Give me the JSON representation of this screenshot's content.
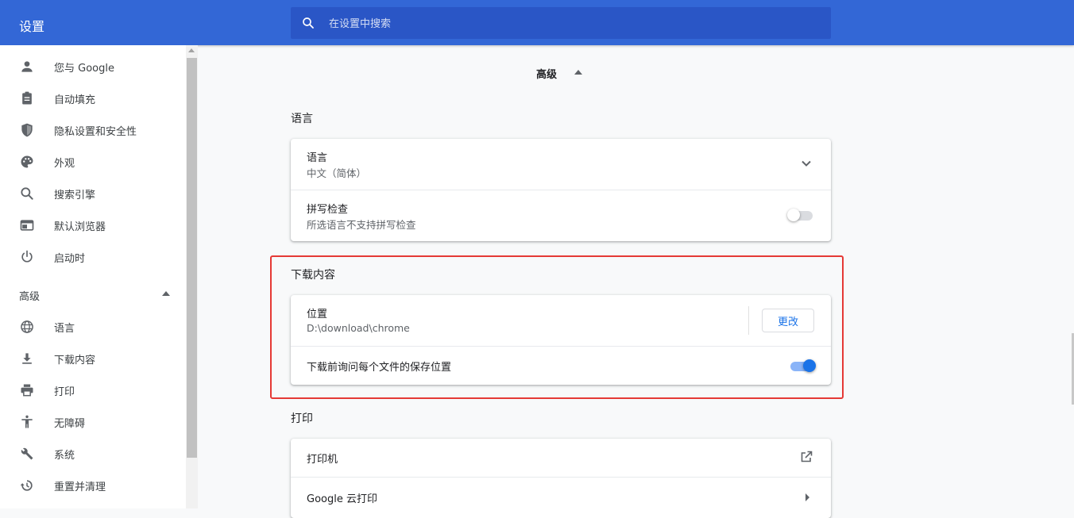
{
  "header": {
    "title": "设置",
    "search_placeholder": "在设置中搜索"
  },
  "sidebar": {
    "items": [
      {
        "label": "您与 Google",
        "icon": "person-icon"
      },
      {
        "label": "自动填充",
        "icon": "clipboard-icon"
      },
      {
        "label": "隐私设置和安全性",
        "icon": "shield-icon"
      },
      {
        "label": "外观",
        "icon": "palette-icon"
      },
      {
        "label": "搜索引擎",
        "icon": "search-icon"
      },
      {
        "label": "默认浏览器",
        "icon": "browser-icon"
      },
      {
        "label": "启动时",
        "icon": "power-icon"
      }
    ],
    "advanced_label": "高级",
    "advanced_items": [
      {
        "label": "语言",
        "icon": "globe-icon"
      },
      {
        "label": "下载内容",
        "icon": "download-icon"
      },
      {
        "label": "打印",
        "icon": "printer-icon"
      },
      {
        "label": "无障碍",
        "icon": "accessibility-icon"
      },
      {
        "label": "系统",
        "icon": "wrench-icon"
      },
      {
        "label": "重置并清理",
        "icon": "history-icon"
      }
    ]
  },
  "main": {
    "advanced_heading": "高级",
    "language_section": {
      "title": "语言",
      "language_row": {
        "title": "语言",
        "value": "中文（简体）"
      },
      "spellcheck_row": {
        "title": "拼写检查",
        "subtitle": "所选语言不支持拼写检查",
        "enabled": false
      }
    },
    "downloads_section": {
      "title": "下载内容",
      "location_row": {
        "title": "位置",
        "value": "D:\\download\\chrome",
        "button_label": "更改"
      },
      "ask_row": {
        "title": "下载前询问每个文件的保存位置",
        "enabled": true
      }
    },
    "print_section": {
      "title": "打印",
      "printers_row": {
        "title": "打印机"
      },
      "cloud_print_row": {
        "title": "Google 云打印"
      }
    }
  },
  "colors": {
    "header_bg": "#3367d6",
    "accent": "#1a73e8",
    "highlight_border": "#e53935"
  }
}
